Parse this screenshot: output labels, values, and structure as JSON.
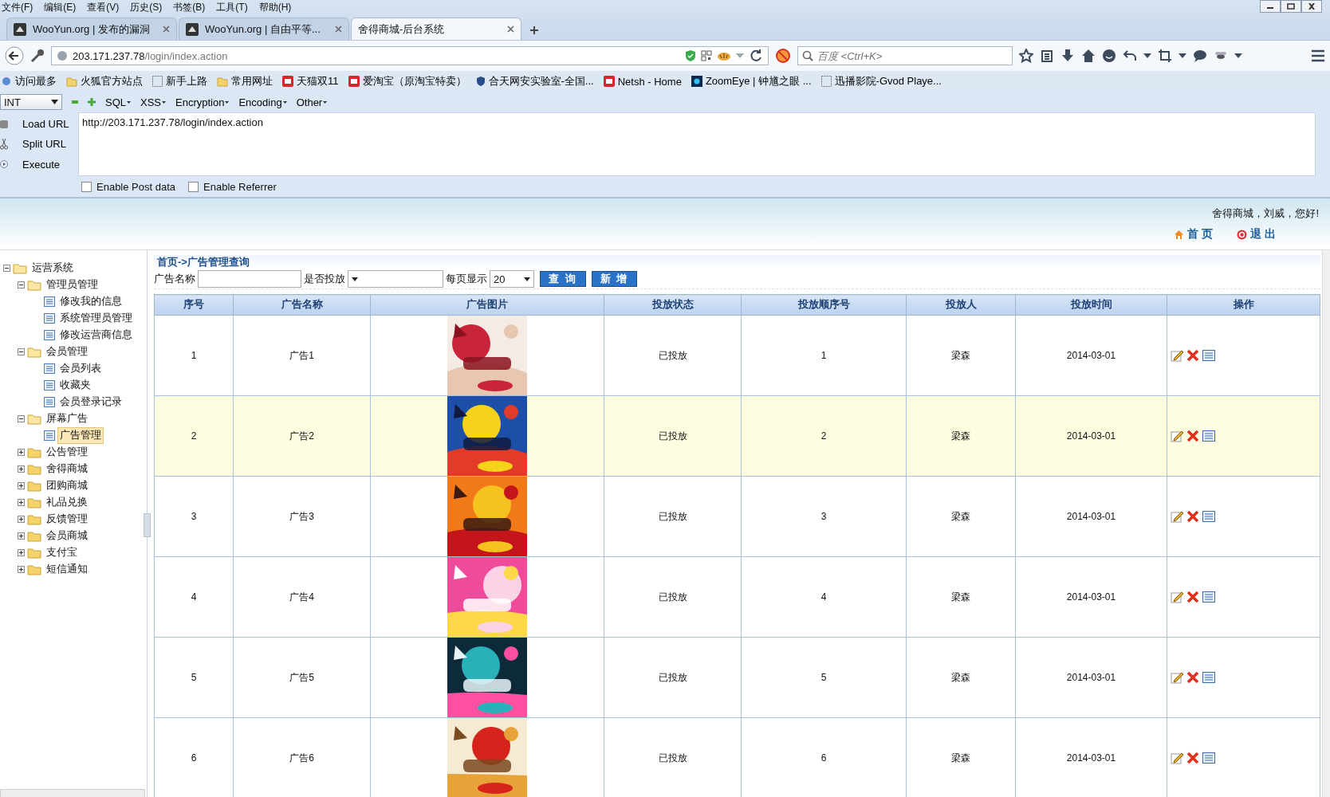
{
  "browser_menu": [
    "文件(F)",
    "编辑(E)",
    "查看(V)",
    "历史(S)",
    "书签(B)",
    "工具(T)",
    "帮助(H)"
  ],
  "tabs": [
    {
      "title": "WooYun.org | 发布的漏洞",
      "selected": false
    },
    {
      "title": "WooYun.org | 自由平等...",
      "selected": false
    },
    {
      "title": "舍得商城-后台系统",
      "selected": true
    }
  ],
  "address_bar": {
    "host": "203.171.237.78",
    "path": "/login/index.action"
  },
  "search_field": {
    "placeholder": "百度 <Ctrl+K>"
  },
  "bookmarks": [
    {
      "label": "访问最多",
      "kind": "smart"
    },
    {
      "label": "火狐官方站点",
      "kind": "folder"
    },
    {
      "label": "新手上路",
      "kind": "page"
    },
    {
      "label": "常用网址",
      "kind": "folder"
    },
    {
      "label": "天猫双11",
      "kind": "site"
    },
    {
      "label": "爱淘宝（原淘宝特卖）",
      "kind": "site"
    },
    {
      "label": "合天网安实验室-全国...",
      "kind": "shield"
    },
    {
      "label": "Netsh - Home",
      "kind": "site"
    },
    {
      "label": "ZoomEye | 钟馗之眼 ...",
      "kind": "eye"
    },
    {
      "label": "迅播影院-Gvod Playe...",
      "kind": "page"
    }
  ],
  "hackbar": {
    "type_select": "INT",
    "menus": [
      "SQL",
      "XSS",
      "Encryption",
      "Encoding",
      "Other"
    ],
    "actions": [
      "Load URL",
      "Split URL",
      "Execute"
    ],
    "url_text": "http://203.171.237.78/login/index.action",
    "options": [
      {
        "label": "Enable Post data",
        "checked": false
      },
      {
        "label": "Enable Referrer",
        "checked": false
      }
    ]
  },
  "header": {
    "greeting": "舍得商城，刘威，您好!",
    "links": [
      {
        "label": "首 页",
        "kind": "home"
      },
      {
        "label": "退 出",
        "kind": "logout"
      }
    ]
  },
  "sidebar": {
    "tree": [
      {
        "label": "运营系统",
        "expanded": true,
        "selected": false,
        "children": [
          {
            "label": "管理员管理",
            "expanded": true,
            "selected": false,
            "children": [
              {
                "label": "修改我的信息",
                "selected": false
              },
              {
                "label": "系统管理员管理",
                "selected": false
              },
              {
                "label": "修改运营商信息",
                "selected": false
              }
            ]
          },
          {
            "label": "会员管理",
            "expanded": true,
            "selected": false,
            "children": [
              {
                "label": "会员列表",
                "selected": false
              },
              {
                "label": "收藏夹",
                "selected": false
              },
              {
                "label": "会员登录记录",
                "selected": false
              }
            ]
          },
          {
            "label": "屏幕广告",
            "expanded": true,
            "selected": false,
            "children": [
              {
                "label": "广告管理",
                "selected": true
              }
            ]
          },
          {
            "label": "公告管理",
            "expanded": false,
            "selected": false
          },
          {
            "label": "舍得商城",
            "expanded": false,
            "selected": false
          },
          {
            "label": "团购商城",
            "expanded": false,
            "selected": false
          },
          {
            "label": "礼品兑换",
            "expanded": false,
            "selected": false
          },
          {
            "label": "反馈管理",
            "expanded": false,
            "selected": false
          },
          {
            "label": "会员商城",
            "expanded": false,
            "selected": false
          },
          {
            "label": "支付宝",
            "expanded": false,
            "selected": false
          },
          {
            "label": "短信通知",
            "expanded": false,
            "selected": false
          }
        ]
      }
    ]
  },
  "content": {
    "breadcrumb": "首页->广告管理查询",
    "filters": {
      "name_label": "广告名称",
      "status_label": "是否投放",
      "page_size_label": "每页显示",
      "page_size": "20",
      "buttons": [
        "查 询",
        "新 增"
      ]
    },
    "table": {
      "columns": [
        "序号",
        "广告名称",
        "广告图片",
        "投放状态",
        "投放顺序号",
        "投放人",
        "投放时间",
        "操作"
      ],
      "rows": [
        {
          "no": "1",
          "name": "广告1",
          "status": "已投放",
          "order": "1",
          "person": "梁森",
          "time": "2014-03-01",
          "selected": false
        },
        {
          "no": "2",
          "name": "广告2",
          "status": "已投放",
          "order": "2",
          "person": "梁森",
          "time": "2014-03-01",
          "selected": true
        },
        {
          "no": "3",
          "name": "广告3",
          "status": "已投放",
          "order": "3",
          "person": "梁森",
          "time": "2014-03-01",
          "selected": false
        },
        {
          "no": "4",
          "name": "广告4",
          "status": "已投放",
          "order": "4",
          "person": "梁森",
          "time": "2014-03-01",
          "selected": false
        },
        {
          "no": "5",
          "name": "广告5",
          "status": "已投放",
          "order": "5",
          "person": "梁森",
          "time": "2014-03-01",
          "selected": false
        },
        {
          "no": "6",
          "name": "广告6",
          "status": "已投放",
          "order": "6",
          "person": "梁森",
          "time": "2014-03-01",
          "selected": false
        }
      ]
    }
  }
}
